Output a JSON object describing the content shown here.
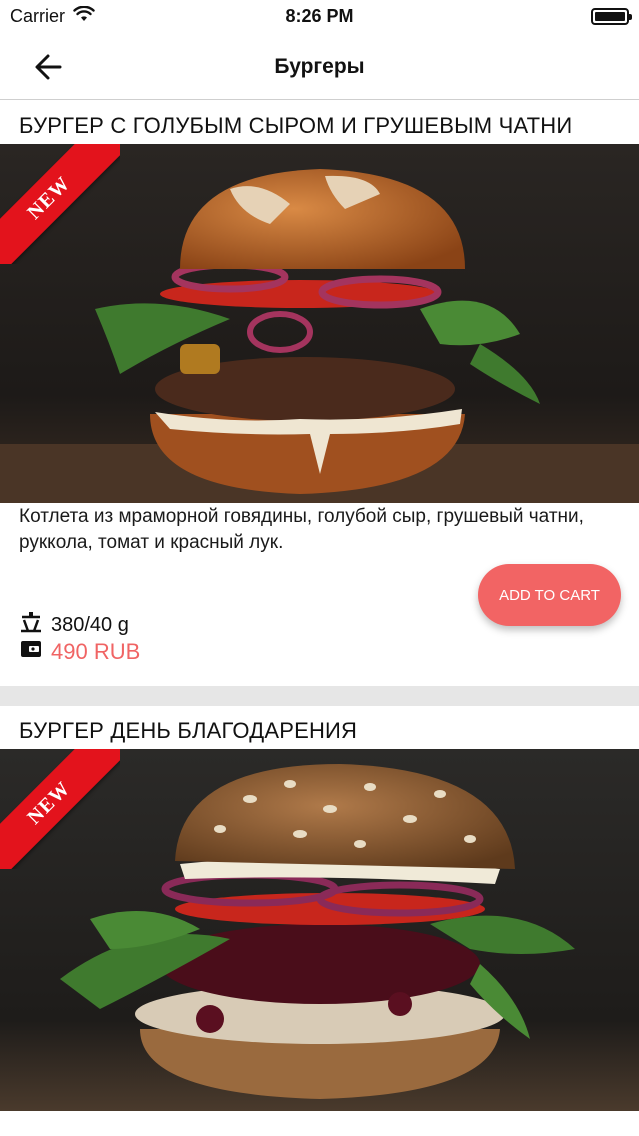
{
  "status_bar": {
    "carrier": "Carrier",
    "time": "8:26 PM"
  },
  "nav": {
    "title": "Бургеры"
  },
  "products": [
    {
      "title": "БУРГЕР С ГОЛУБЫМ СЫРОМ И ГРУШЕВЫМ ЧАТНИ",
      "badge": "NEW",
      "description": "Котлета из мраморной говядины, голубой сыр, грушевый чатни, руккола, томат и красный лук.",
      "weight": "380/40 g",
      "price": "490 RUB",
      "add_to_cart_label": "ADD TO CART"
    },
    {
      "title": "БУРГЕР ДЕНЬ БЛАГОДАРЕНИЯ",
      "badge": "NEW"
    }
  ],
  "colors": {
    "accent": "#f26464",
    "price": "#f06464",
    "ribbon": "#e3131c",
    "separator": "#e6e6e6"
  },
  "icons": [
    "wifi-icon",
    "battery-icon",
    "back-arrow-icon",
    "scale-icon",
    "wallet-icon"
  ]
}
